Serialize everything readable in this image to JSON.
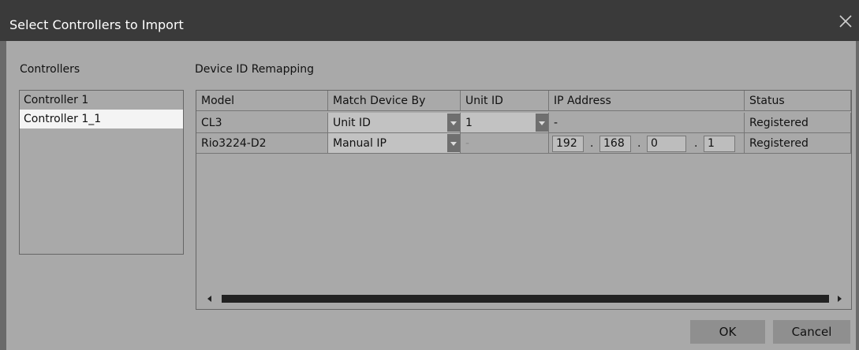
{
  "window": {
    "title": "Select Controllers to Import"
  },
  "controllers": {
    "heading": "Controllers",
    "items": [
      {
        "label": "Controller 1",
        "selected": false
      },
      {
        "label": "Controller 1_1",
        "selected": true
      }
    ]
  },
  "remap": {
    "heading": "Device ID Remapping",
    "columns": [
      "Model",
      "Match Device By",
      "Unit ID",
      "IP Address",
      "Status"
    ],
    "rows": [
      {
        "model": "CL3",
        "match": "Unit ID",
        "unit_id": "1",
        "ip_text": "-",
        "status": "Registered"
      },
      {
        "model": "Rio3224-D2",
        "match": "Manual IP",
        "unit_id": "-",
        "ip": [
          "192",
          "168",
          "0",
          "1"
        ],
        "ip_sep": ".",
        "status": "Registered"
      }
    ]
  },
  "buttons": {
    "ok": "OK",
    "cancel": "Cancel"
  },
  "icons": {
    "close": "close-icon",
    "dropdown": "chevron-down-icon",
    "scroll_left": "arrow-left-icon",
    "scroll_right": "arrow-right-icon"
  }
}
